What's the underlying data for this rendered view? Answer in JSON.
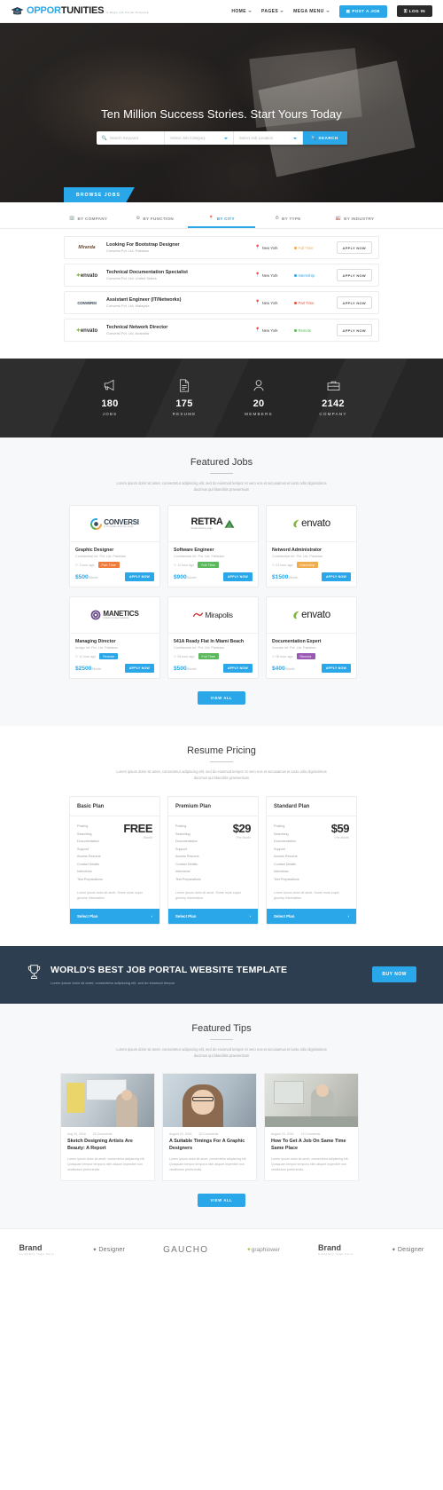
{
  "header": {
    "logo": {
      "text_a": "OPPOR",
      "text_b": "TUNITIES",
      "tagline": "A Mega Job Portal Template",
      "icon": "graduation-cap-icon"
    },
    "nav": [
      {
        "label": "HOME",
        "caret": true
      },
      {
        "label": "PAGES",
        "caret": true
      },
      {
        "label": "MEGA MENU",
        "caret": true
      }
    ],
    "post_job_label": "POST A JOB",
    "post_job_icon": "briefcase-icon",
    "login_label": "LOG IN",
    "login_icon": "lock-icon"
  },
  "hero": {
    "title": "Ten Million Success Stories. Start Yours Today",
    "search": {
      "keyword_placeholder": "Search Keyword",
      "keyword_icon": "search-icon",
      "category_placeholder": "Select Job Category",
      "location_placeholder": "Select Job Location",
      "button_label": "SEARCH",
      "button_icon": "search-icon"
    },
    "browse_tab_label": "BROWSE JOBS"
  },
  "browse": {
    "tabs": [
      {
        "label": "BY COMPANY",
        "icon": "building-icon",
        "active": false
      },
      {
        "label": "BY FUNCTION",
        "icon": "cog-icon",
        "active": false
      },
      {
        "label": "BY CITY",
        "icon": "map-pin-icon",
        "active": true
      },
      {
        "label": "BY TYPE",
        "icon": "clock-icon",
        "active": false
      },
      {
        "label": "BY INDUSTRY",
        "icon": "industry-icon",
        "active": false
      }
    ],
    "apply_label": "APPLY NOW",
    "jobs": [
      {
        "logo": "Miranda",
        "logo_style": "miranda",
        "title": "Looking For Bootstrap Designer",
        "company": "Conversi Pvt. Ltd. Pakistan",
        "location": "New York",
        "type": "Full Time",
        "type_color": "#f0ad4e"
      },
      {
        "logo": "envato",
        "logo_style": "envato",
        "title": "Technical Documentation Specialist",
        "company": "Conversi Pvt. Ltd. United States",
        "location": "New York",
        "type": "Internship",
        "type_color": "#2aa7e8"
      },
      {
        "logo": "CONVERSI",
        "logo_style": "conversi",
        "title": "Assistant Engineer (IT/Networks)",
        "company": "Conversi Pvt. Ltd. Malaysia",
        "location": "New York",
        "type": "Part Time",
        "type_color": "#e8543f"
      },
      {
        "logo": "envato",
        "logo_style": "envato",
        "title": "Technical Network Director",
        "company": "Conversi Pvt. Ltd. Australia",
        "location": "New York",
        "type": "Remote",
        "type_color": "#5cb85c"
      }
    ]
  },
  "counters": [
    {
      "value": "180",
      "label": "JOBS",
      "icon": "megaphone-icon"
    },
    {
      "value": "175",
      "label": "RESUME",
      "icon": "document-icon"
    },
    {
      "value": "20",
      "label": "MEMBERS",
      "icon": "user-icon"
    },
    {
      "value": "2142",
      "label": "COMPANY",
      "icon": "briefcase-icon"
    }
  ],
  "featured_jobs": {
    "title": "Featured Jobs",
    "description": "Lorem ipsum dolor sit amet, consectetur adipiscing elit, sed do eiusmod tempor At vero eos et accusamus et iusto odio dignissimos ducimus qui blanditiis praesentium",
    "view_all_label": "VIEW ALL",
    "apply_label": "APPLY NOW",
    "cards": [
      {
        "logo": "CONVERSI",
        "logo_sub": "A Template Dummy Logo",
        "logo_style": "conversi",
        "title": "Graphic Designer",
        "company": "Confidential Inf. Pvt. Ltd. Pakistan",
        "time": "1 hour ago",
        "badge": "Part Time",
        "badge_color": "#f07b3f",
        "price": "$500",
        "price_unit": "/Month"
      },
      {
        "logo": "RETRA",
        "logo_sub": "Simple Dummy Logo",
        "logo_style": "retra",
        "title": "Software Engineer",
        "company": "Confidential Inf. Pvt. Ltd. Pakistan",
        "time": "11 hour ago",
        "badge": "Full Time",
        "badge_color": "#5cb85c",
        "price": "$900",
        "price_unit": "/Month"
      },
      {
        "logo": "envato",
        "logo_sub": "",
        "logo_style": "envato",
        "title": "Netword Administrator",
        "company": "Confidential Inf. Pvt. Ltd. Pakistan",
        "time": "01 hour ago",
        "badge": "Internship",
        "badge_color": "#f0ad4e",
        "price": "$1500",
        "price_unit": "/Month"
      },
      {
        "logo": "MANETICS",
        "logo_sub": "A Dummy Logo Solutions",
        "logo_style": "manetics",
        "title": "Managing Director",
        "company": "Amigo Inf. Pvt. Ltd. Pakistan",
        "time": "11 hour ago",
        "badge": "Remote",
        "badge_color": "#2aa7e8",
        "price": "$2500",
        "price_unit": "/Month"
      },
      {
        "logo": "Mirapolis",
        "logo_sub": "",
        "logo_style": "mirapolis",
        "title": "541A Ready Flat In Miami Beach",
        "company": "Confidential Inf. Pvt. Ltd. Pakistan",
        "time": "09 hour ago",
        "badge": "Full Time",
        "badge_color": "#5cb85c",
        "price": "$500",
        "price_unit": "/Month"
      },
      {
        "logo": "envato",
        "logo_sub": "",
        "logo_style": "envato",
        "title": "Documentation Expert",
        "company": "Vcorals Inf. Pvt. Ltd. Pakistan",
        "time": "05 hour ago",
        "badge": "Remote",
        "badge_color": "#9b59b6",
        "price": "$400",
        "price_unit": "/Month"
      }
    ]
  },
  "pricing": {
    "title": "Resume Pricing",
    "description": "Lorem ipsum dolor sit amet, consectetur adipiscing elit, sed do eiusmod tempor At vero eos et accusamus et iusto odio dignissimos ducimus qui blanditiis praesentium",
    "select_label": "Select Plan",
    "note": "Lorem ipsum dolor sit amet. Some more super grocery information",
    "features": [
      "Posting",
      "Searching",
      "Documentation",
      "Support",
      "Access Resume",
      "Contact Details",
      "Interviews",
      "Test Preparations"
    ],
    "plans": [
      {
        "name": "Basic Plan",
        "price": "FREE",
        "period": "/Month"
      },
      {
        "name": "Premium Plan",
        "price": "$29",
        "period": "Per Month"
      },
      {
        "name": "Standard Plan",
        "price": "$59",
        "period": "Per Month"
      }
    ]
  },
  "cta": {
    "icon": "trophy-icon",
    "title": "WORLD'S BEST JOB PORTAL WEBSITE TEMPLATE",
    "subtitle": "Lorem ipsum dolor sit amet, consectetur adipiscing elit, sed do eiusmod tempor",
    "button_label": "BUY NOW"
  },
  "tips": {
    "title": "Featured Tips",
    "description": "Lorem ipsum dolor sit amet, consectetur adipiscing elit, sed do eiusmod tempor At vero eos et accusamus et iusto odio dignissimos ducimus qui blanditiis praesentium",
    "view_all_label": "VIEW ALL",
    "posts": [
      {
        "date": "Aug 20, 2016",
        "comments": "20 Comments",
        "title": "Sketch Designing Artists Are Beauty: A Report",
        "excerpt": "Lorem ipsum dolor sit amet, consectetur adipiscing elit. Quisquam tempor tempora nibh aliquet imperdiet non vestibulum perferendis.",
        "img": "office-woman-yellow"
      },
      {
        "date": "August 20, 2016",
        "comments": "20 Comments",
        "title": "A Suitable Timings For A Graphic Designers",
        "excerpt": "Lorem ipsum dolor sit amet, consectetur adipiscing elit. Quisquam tempor tempora nibh aliquet imperdiet non vestibulum perferendis.",
        "img": "woman-glasses"
      },
      {
        "date": "August 20, 2016",
        "comments": "13 Comments",
        "title": "How To Get A Job On Same Time Same Place",
        "excerpt": "Lorem ipsum dolor sit amet, consectetur adipiscing elit. Quisquam tempor tempora nibh aliquet imperdiet non vestibulum perferendis.",
        "img": "man-desk"
      }
    ]
  },
  "brands": [
    {
      "name": "Brand",
      "sub": "Company logo here",
      "style": "b1"
    },
    {
      "name": "Designer",
      "style": "b2",
      "icon": "star-icon"
    },
    {
      "name": "GAUCHO",
      "style": "b3"
    },
    {
      "name": "graphiower",
      "style": "b4",
      "icon": "leaf-icon"
    },
    {
      "name": "Brand",
      "sub": "Company logo here",
      "style": "b1"
    },
    {
      "name": "Designer",
      "style": "b2",
      "icon": "star-icon"
    }
  ]
}
